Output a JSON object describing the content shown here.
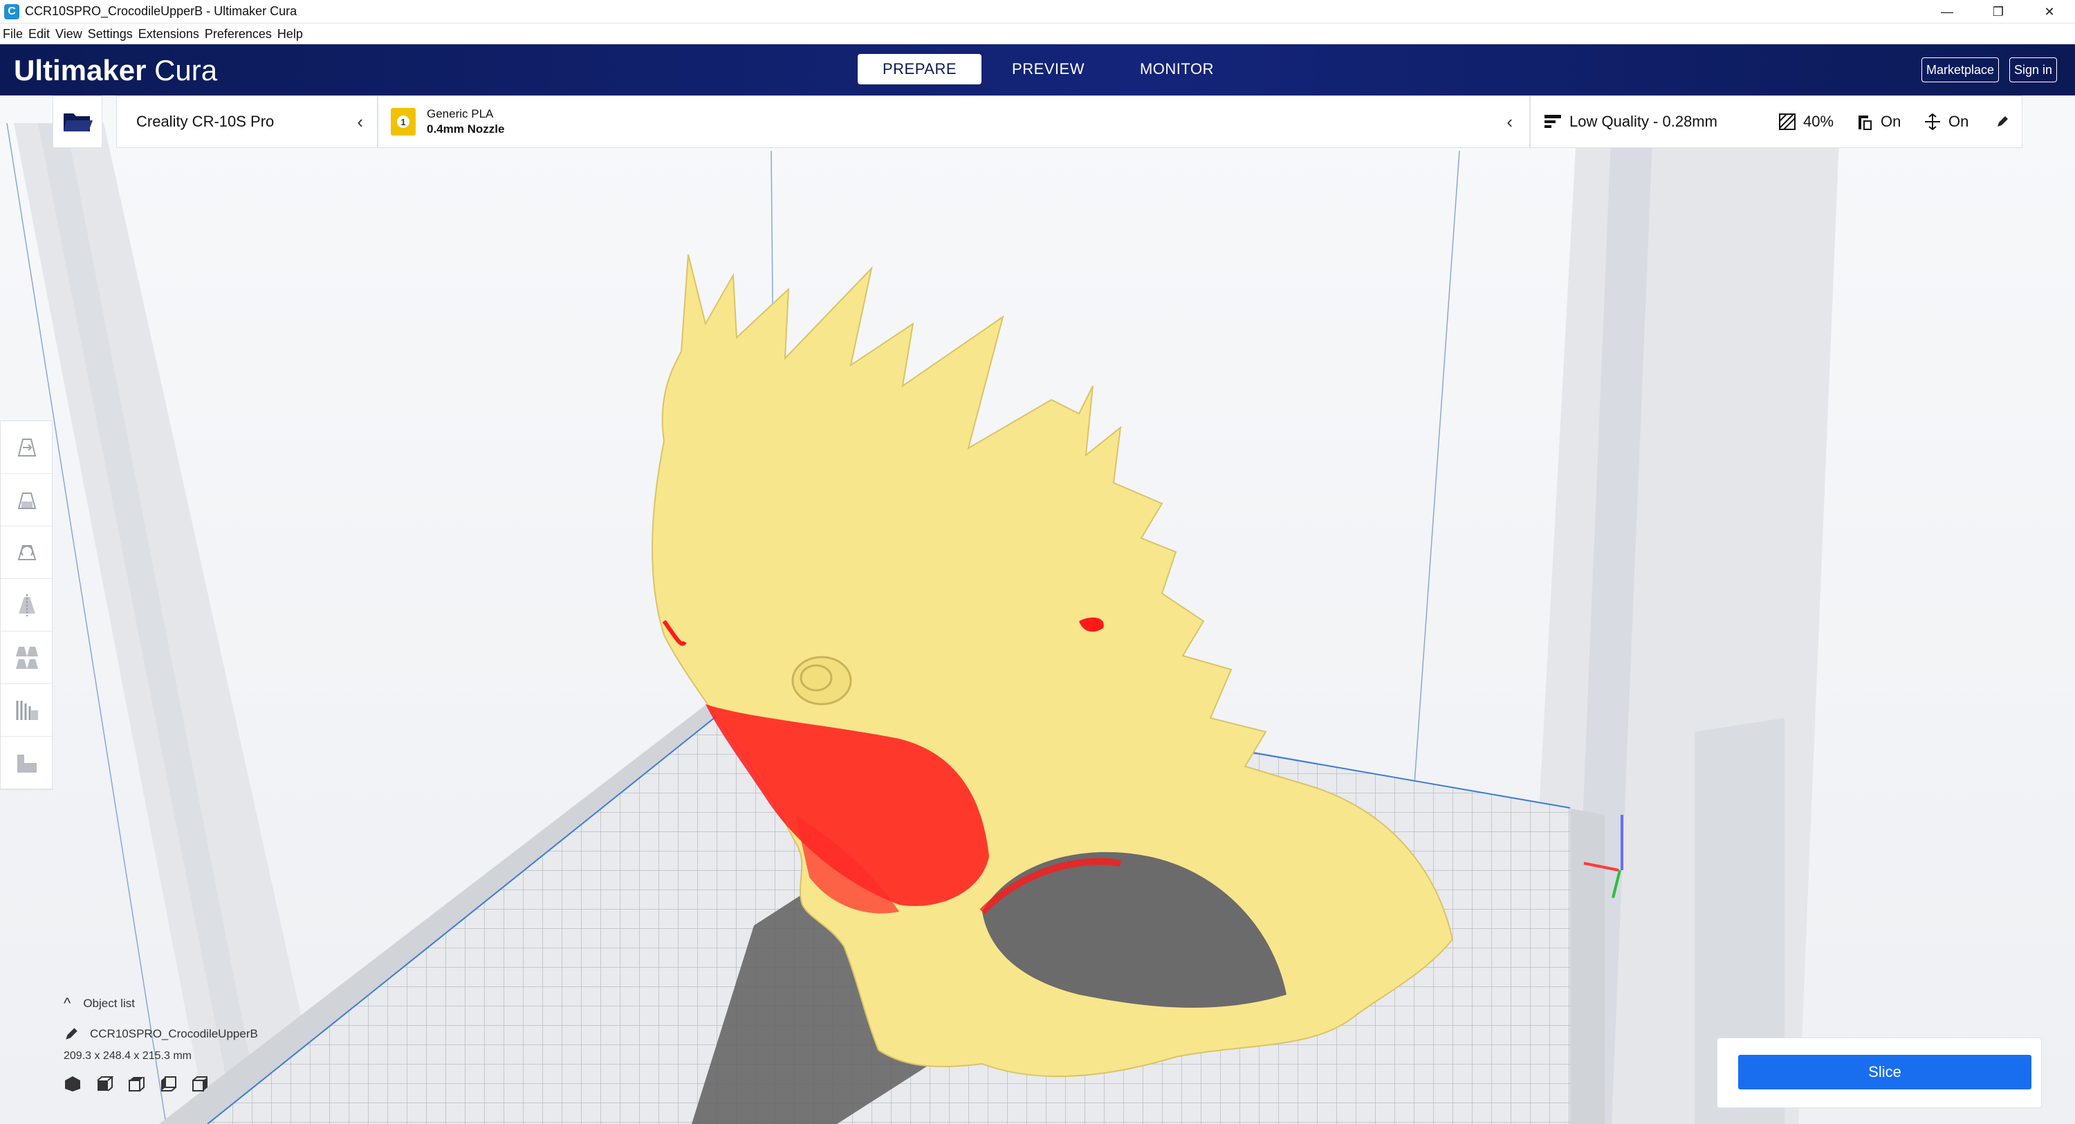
{
  "window": {
    "title": "CCR10SPRO_CrocodileUpperB - Ultimaker Cura",
    "minimize": "—",
    "restore": "❐",
    "close": "✕"
  },
  "menu": [
    "File",
    "Edit",
    "View",
    "Settings",
    "Extensions",
    "Preferences",
    "Help"
  ],
  "header": {
    "brand_bold": "Ultimaker",
    "brand_light": "Cura",
    "tabs": [
      {
        "label": "PREPARE",
        "active": true
      },
      {
        "label": "PREVIEW",
        "active": false
      },
      {
        "label": "MONITOR",
        "active": false
      }
    ],
    "marketplace": "Marketplace",
    "sign_in": "Sign in"
  },
  "printer": {
    "name": "Creality CR-10S Pro"
  },
  "material": {
    "extruder": "1",
    "name": "Generic PLA",
    "nozzle": "0.4mm Nozzle"
  },
  "print_settings": {
    "profile": "Low Quality - 0.28mm",
    "infill": "40%",
    "support": "On",
    "adhesion": "On"
  },
  "object_list": {
    "label": "Object list",
    "object_name": "CCR10SPRO_CrocodileUpperB",
    "dimensions": "209.3 x 248.4 x 215.3 mm"
  },
  "slice": {
    "label": "Slice"
  },
  "colors": {
    "header_bg": "#0b1a56",
    "accent_blue": "#196ef0",
    "model_yellow": "#f8e68c",
    "overhang_red": "#ff0000",
    "material_badge": "#f2c200"
  }
}
